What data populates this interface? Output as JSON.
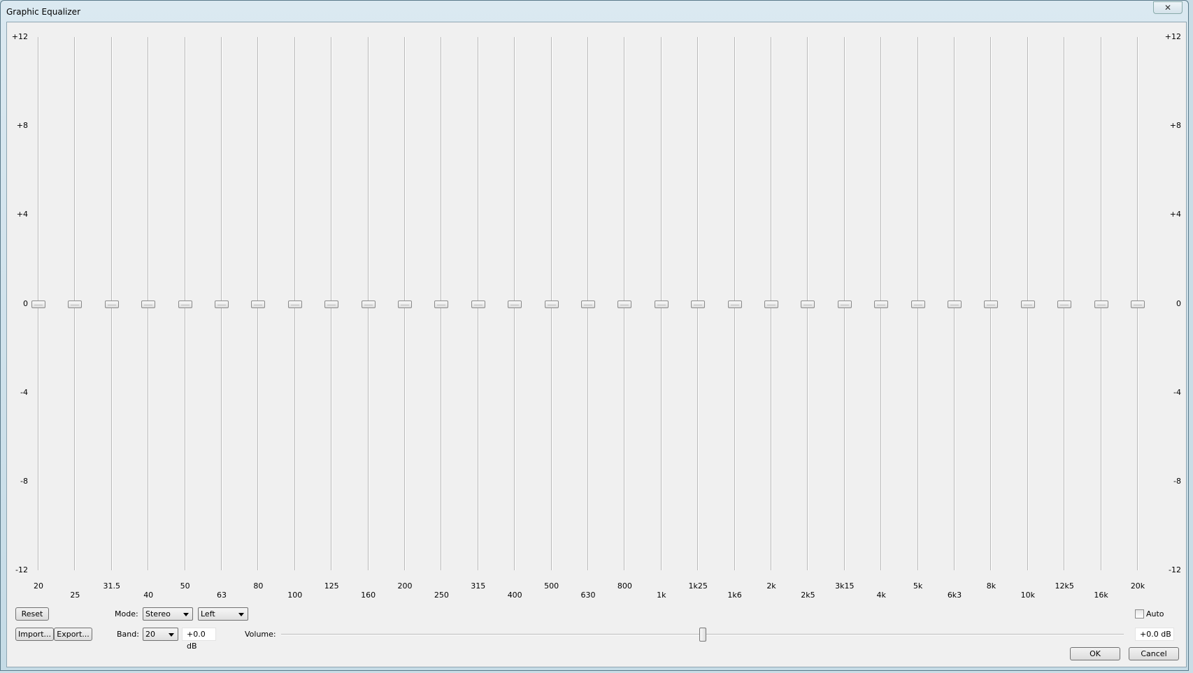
{
  "window": {
    "title": "Graphic Equalizer",
    "close_icon": "close-icon"
  },
  "axis": {
    "left": [
      "+12",
      "+8",
      "+4",
      "0",
      "-4",
      "-8",
      "-12"
    ],
    "right": [
      "+12",
      "+8",
      "+4",
      "0",
      "-4",
      "-8",
      "-12"
    ],
    "ticks_db": [
      12,
      8,
      4,
      0,
      -4,
      -8,
      -12
    ]
  },
  "bands": [
    {
      "label": "20",
      "value_db": 0
    },
    {
      "label": "25",
      "value_db": 0
    },
    {
      "label": "31.5",
      "value_db": 0
    },
    {
      "label": "40",
      "value_db": 0
    },
    {
      "label": "50",
      "value_db": 0
    },
    {
      "label": "63",
      "value_db": 0
    },
    {
      "label": "80",
      "value_db": 0
    },
    {
      "label": "100",
      "value_db": 0
    },
    {
      "label": "125",
      "value_db": 0
    },
    {
      "label": "160",
      "value_db": 0
    },
    {
      "label": "200",
      "value_db": 0
    },
    {
      "label": "250",
      "value_db": 0
    },
    {
      "label": "315",
      "value_db": 0
    },
    {
      "label": "400",
      "value_db": 0
    },
    {
      "label": "500",
      "value_db": 0
    },
    {
      "label": "630",
      "value_db": 0
    },
    {
      "label": "800",
      "value_db": 0
    },
    {
      "label": "1k",
      "value_db": 0
    },
    {
      "label": "1k25",
      "value_db": 0
    },
    {
      "label": "1k6",
      "value_db": 0
    },
    {
      "label": "2k",
      "value_db": 0
    },
    {
      "label": "2k5",
      "value_db": 0
    },
    {
      "label": "3k15",
      "value_db": 0
    },
    {
      "label": "4k",
      "value_db": 0
    },
    {
      "label": "5k",
      "value_db": 0
    },
    {
      "label": "6k3",
      "value_db": 0
    },
    {
      "label": "8k",
      "value_db": 0
    },
    {
      "label": "10k",
      "value_db": 0
    },
    {
      "label": "12k5",
      "value_db": 0
    },
    {
      "label": "16k",
      "value_db": 0
    },
    {
      "label": "20k",
      "value_db": 0
    }
  ],
  "controls": {
    "reset": "Reset",
    "import": "Import...",
    "export": "Export...",
    "mode_label": "Mode:",
    "mode_value": "Stereo",
    "channel_value": "Left",
    "band_label": "Band:",
    "band_value": "20",
    "band_gain": "+0.0 dB",
    "volume_label": "Volume:",
    "volume_db": 0,
    "volume_value": "+0.0 dB",
    "auto_label": "Auto",
    "auto_checked": false,
    "ok": "OK",
    "cancel": "Cancel"
  }
}
